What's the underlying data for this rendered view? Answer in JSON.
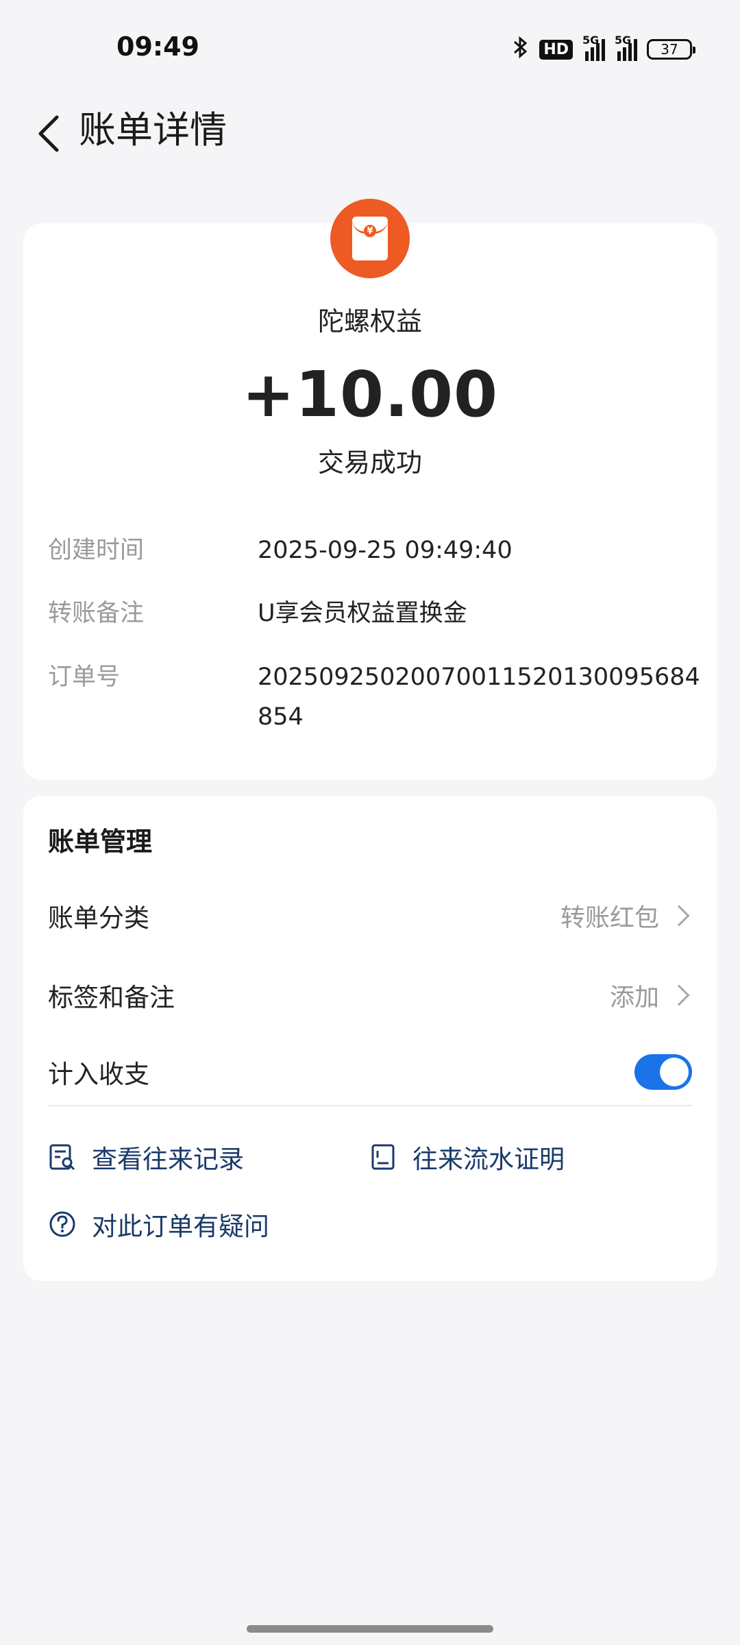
{
  "status_bar": {
    "time": "09:49",
    "network_1": "5G",
    "network_2": "5G",
    "hd_badge": "HD",
    "battery": "37"
  },
  "header": {
    "title": "账单详情"
  },
  "transaction": {
    "merchant": "陀螺权益",
    "amount": "+10.00",
    "status": "交易成功",
    "icon_color": "#ee5a24",
    "rows": [
      {
        "label": "创建时间",
        "value": "2025-09-25 09:49:40"
      },
      {
        "label": "转账备注",
        "value": "U享会员权益置换金"
      },
      {
        "label": "订单号",
        "value": "20250925020070011520130095684854"
      }
    ]
  },
  "management": {
    "title": "账单管理",
    "category": {
      "label": "账单分类",
      "value": "转账红包"
    },
    "tags": {
      "label": "标签和备注",
      "value": "添加"
    },
    "include": {
      "label": "计入收支",
      "enabled": true
    },
    "links": {
      "records": "查看往来记录",
      "proof": "往来流水证明",
      "question": "对此订单有疑问"
    },
    "accent_color": "#1a73e8"
  }
}
